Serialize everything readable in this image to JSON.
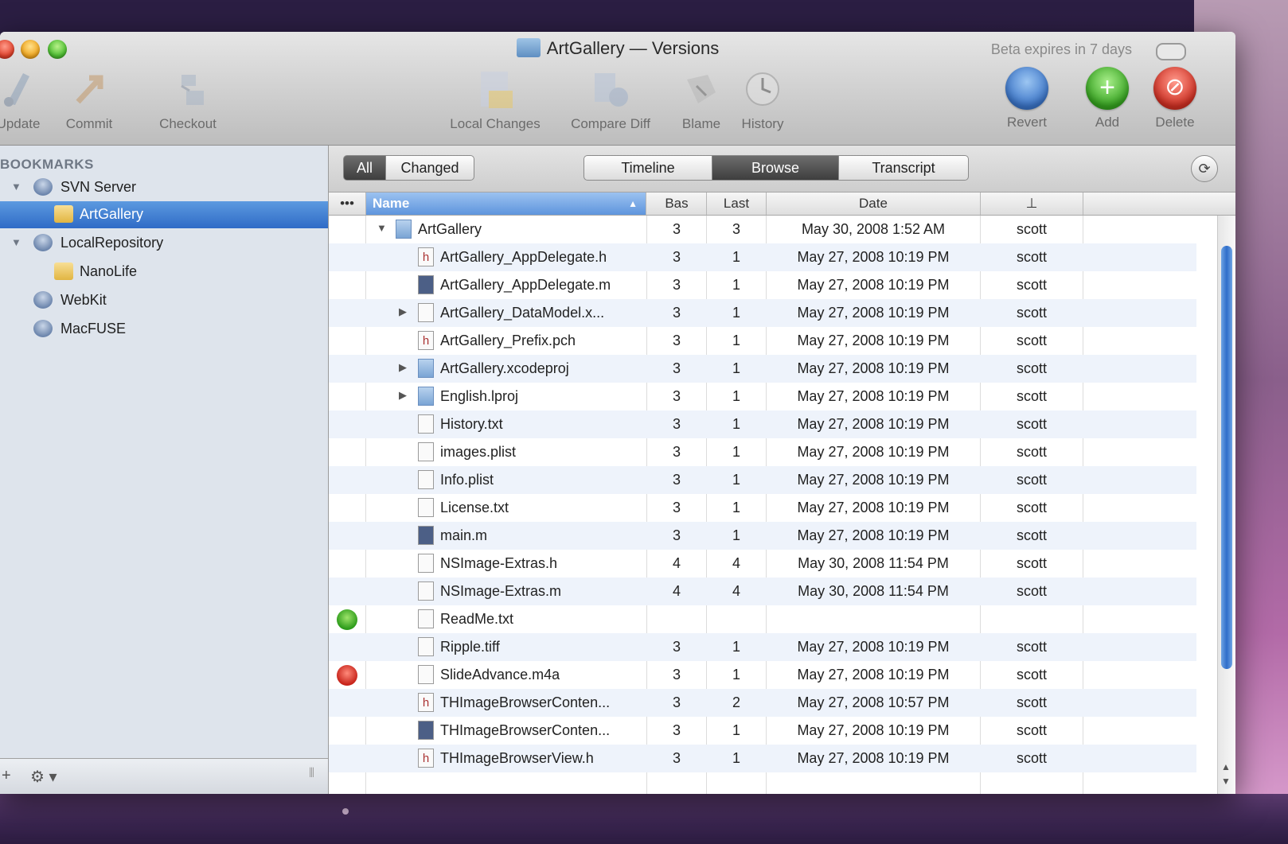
{
  "window": {
    "title": "ArtGallery — Versions",
    "beta_notice": "Beta expires in 7 days"
  },
  "toolbar": {
    "left": [
      {
        "label": "Update",
        "icon": "update-icon"
      },
      {
        "label": "Commit",
        "icon": "commit-icon"
      },
      {
        "label": "Checkout",
        "icon": "checkout-icon"
      }
    ],
    "center": [
      {
        "label": "Local Changes",
        "icon": "local-changes-icon"
      },
      {
        "label": "Compare Diff",
        "icon": "compare-diff-icon"
      },
      {
        "label": "Blame",
        "icon": "blame-icon"
      },
      {
        "label": "History",
        "icon": "history-icon"
      }
    ],
    "right": [
      {
        "label": "Revert",
        "icon": "revert-icon",
        "color": "#4b86d6"
      },
      {
        "label": "Add",
        "icon": "add-icon",
        "color": "#3fae2a"
      },
      {
        "label": "Delete",
        "icon": "delete-icon",
        "color": "#d6362a"
      }
    ]
  },
  "sidebar": {
    "header": "BOOKMARKS",
    "items": [
      {
        "label": "SVN Server",
        "type": "server",
        "expanded": true
      },
      {
        "label": "ArtGallery",
        "type": "folder",
        "selected": true
      },
      {
        "label": "LocalRepository",
        "type": "server",
        "expanded": true
      },
      {
        "label": "NanoLife",
        "type": "folder"
      },
      {
        "label": "WebKit",
        "type": "server"
      },
      {
        "label": "MacFUSE",
        "type": "server"
      }
    ],
    "bottom": {
      "add": "+",
      "gear": "⚙ ▾",
      "resize": "⦀"
    }
  },
  "filter": {
    "all": "All",
    "changed": "Changed"
  },
  "views": {
    "timeline": "Timeline",
    "browse": "Browse",
    "transcript": "Transcript",
    "active": "Browse"
  },
  "columns": {
    "status": "•••",
    "name": "Name",
    "bas": "Bas",
    "last": "Last",
    "date": "Date",
    "author": "⊥"
  },
  "files": [
    {
      "name": "ArtGallery",
      "kind": "folder",
      "bas": "3",
      "last": "3",
      "date": "May 30, 2008 1:52 AM",
      "author": "scott",
      "disclosure": "▼",
      "indent": 0
    },
    {
      "name": "ArtGallery_AppDelegate.h",
      "kind": "h",
      "bas": "3",
      "last": "1",
      "date": "May 27, 2008 10:19 PM",
      "author": "scott",
      "indent": 1
    },
    {
      "name": "ArtGallery_AppDelegate.m",
      "kind": "m",
      "bas": "3",
      "last": "1",
      "date": "May 27, 2008 10:19 PM",
      "author": "scott",
      "indent": 1
    },
    {
      "name": "ArtGallery_DataModel.x...",
      "kind": "doc",
      "bas": "3",
      "last": "1",
      "date": "May 27, 2008 10:19 PM",
      "author": "scott",
      "disclosure": "▶",
      "indent": 1
    },
    {
      "name": "ArtGallery_Prefix.pch",
      "kind": "h",
      "bas": "3",
      "last": "1",
      "date": "May 27, 2008 10:19 PM",
      "author": "scott",
      "indent": 1
    },
    {
      "name": "ArtGallery.xcodeproj",
      "kind": "folder",
      "bas": "3",
      "last": "1",
      "date": "May 27, 2008 10:19 PM",
      "author": "scott",
      "disclosure": "▶",
      "indent": 1
    },
    {
      "name": "English.lproj",
      "kind": "folder",
      "bas": "3",
      "last": "1",
      "date": "May 27, 2008 10:19 PM",
      "author": "scott",
      "disclosure": "▶",
      "indent": 1
    },
    {
      "name": "History.txt",
      "kind": "doc",
      "bas": "3",
      "last": "1",
      "date": "May 27, 2008 10:19 PM",
      "author": "scott",
      "indent": 1
    },
    {
      "name": "images.plist",
      "kind": "doc",
      "bas": "3",
      "last": "1",
      "date": "May 27, 2008 10:19 PM",
      "author": "scott",
      "indent": 1
    },
    {
      "name": "Info.plist",
      "kind": "doc",
      "bas": "3",
      "last": "1",
      "date": "May 27, 2008 10:19 PM",
      "author": "scott",
      "indent": 1
    },
    {
      "name": "License.txt",
      "kind": "doc",
      "bas": "3",
      "last": "1",
      "date": "May 27, 2008 10:19 PM",
      "author": "scott",
      "indent": 1
    },
    {
      "name": "main.m",
      "kind": "m",
      "bas": "3",
      "last": "1",
      "date": "May 27, 2008 10:19 PM",
      "author": "scott",
      "indent": 1
    },
    {
      "name": "NSImage-Extras.h",
      "kind": "doc",
      "bas": "4",
      "last": "4",
      "date": "May 30, 2008 11:54 PM",
      "author": "scott",
      "indent": 1
    },
    {
      "name": "NSImage-Extras.m",
      "kind": "doc",
      "bas": "4",
      "last": "4",
      "date": "May 30, 2008 11:54 PM",
      "author": "scott",
      "indent": 1
    },
    {
      "name": "ReadMe.txt",
      "kind": "doc",
      "bas": "",
      "last": "",
      "date": "",
      "author": "",
      "indent": 1,
      "status": "added"
    },
    {
      "name": "Ripple.tiff",
      "kind": "doc",
      "bas": "3",
      "last": "1",
      "date": "May 27, 2008 10:19 PM",
      "author": "scott",
      "indent": 1
    },
    {
      "name": "SlideAdvance.m4a",
      "kind": "doc",
      "bas": "3",
      "last": "1",
      "date": "May 27, 2008 10:19 PM",
      "author": "scott",
      "indent": 1,
      "status": "deleted"
    },
    {
      "name": "THImageBrowserConten...",
      "kind": "h",
      "bas": "3",
      "last": "2",
      "date": "May 27, 2008 10:57 PM",
      "author": "scott",
      "indent": 1
    },
    {
      "name": "THImageBrowserConten...",
      "kind": "m",
      "bas": "3",
      "last": "1",
      "date": "May 27, 2008 10:19 PM",
      "author": "scott",
      "indent": 1
    },
    {
      "name": "THImageBrowserView.h",
      "kind": "h",
      "bas": "3",
      "last": "1",
      "date": "May 27, 2008 10:19 PM",
      "author": "scott",
      "indent": 1
    }
  ]
}
